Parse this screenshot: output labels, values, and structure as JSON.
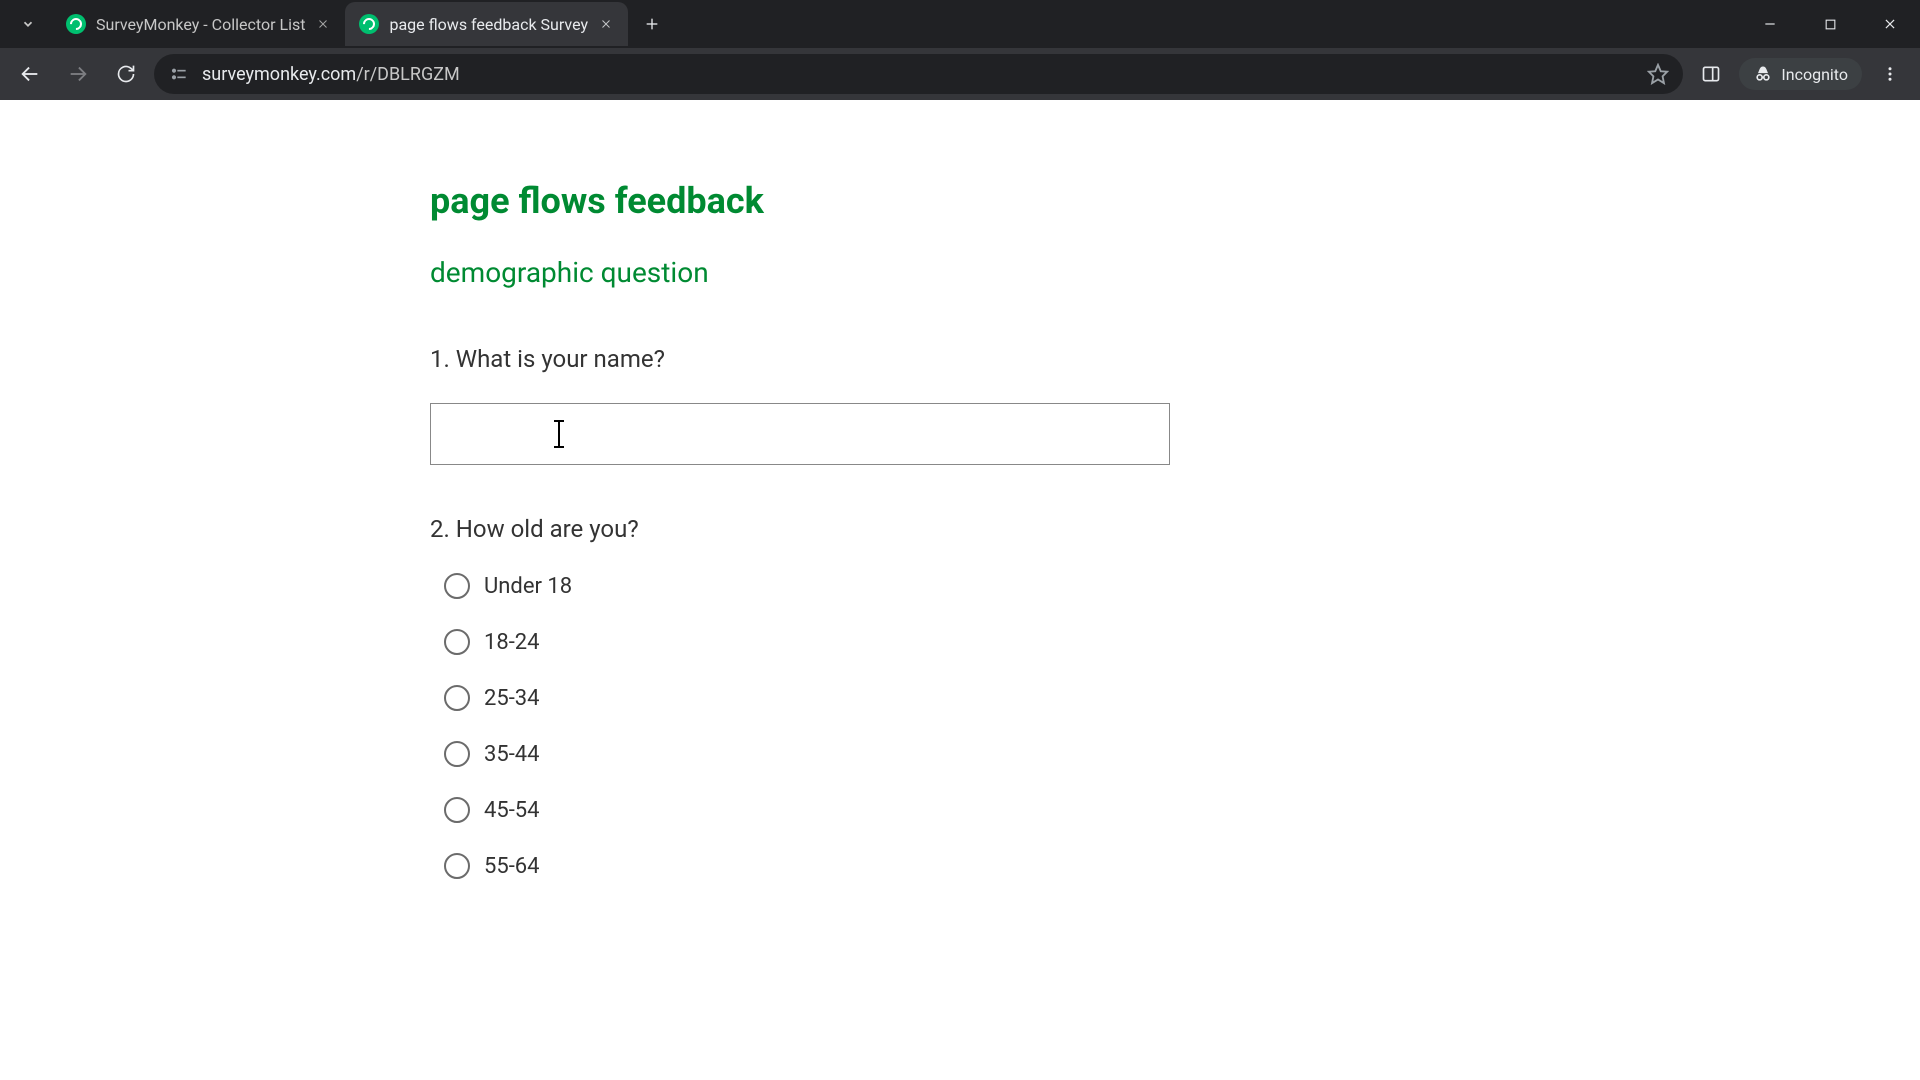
{
  "browser": {
    "tabs": [
      {
        "title": "SurveyMonkey - Collector List",
        "active": false
      },
      {
        "title": "page flows feedback Survey",
        "active": true
      }
    ],
    "url_display": "surveymonkey.com/r/DBLRGZM",
    "url_domain": "surveymonkey.com",
    "url_path": "/r/DBLRGZM",
    "incognito_label": "Incognito"
  },
  "survey": {
    "title": "page flows feedback",
    "section": "demographic question",
    "q1": {
      "number": "1.",
      "text": "What is your name?",
      "value": ""
    },
    "q2": {
      "number": "2.",
      "text": "How old are you?",
      "options": [
        "Under 18",
        "18-24",
        "25-34",
        "35-44",
        "45-54",
        "55-64"
      ]
    }
  }
}
